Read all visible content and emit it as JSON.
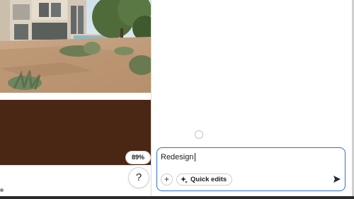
{
  "canvas": {
    "image_alt": "Modern desert house with patio and agave landscaping",
    "swatch_color": "#4a2714",
    "zoom_label": "89%",
    "help_label": "?"
  },
  "composer": {
    "prompt_value": "Redesign",
    "plus_label": "+",
    "quick_edits_label": "Quick edits",
    "accent_color": "#2f6fd6"
  },
  "icons": {
    "help": "question-mark",
    "add": "plus",
    "quick_edits": "sparkle",
    "send": "send-arrow",
    "loading": "spinner-ring"
  }
}
